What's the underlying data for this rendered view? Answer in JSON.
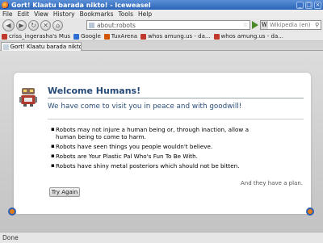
{
  "window": {
    "title": "Gort! Klaatu barada nikto! - Iceweasel",
    "buttons": [
      "_",
      "□",
      "×"
    ]
  },
  "menu": [
    "File",
    "Edit",
    "View",
    "History",
    "Bookmarks",
    "Tools",
    "Help"
  ],
  "nav": {
    "back_icon": "back-arrow",
    "forward_icon": "forward-arrow",
    "reload_icon": "reload",
    "stop_icon": "stop",
    "home_icon": "home",
    "url": "about:robots",
    "search_engine": "W",
    "search_placeholder": "Wikipedia (en)"
  },
  "bookmarks": [
    {
      "label": "criss_ingerasha's Mus",
      "color": "#c0392b"
    },
    {
      "label": "Google",
      "color": "#2f6fd1"
    },
    {
      "label": "TuxArena",
      "color": "#d35400"
    },
    {
      "label": "whos amung.us - da...",
      "color": "#c0392b"
    },
    {
      "label": "whos amung.us - da...",
      "color": "#c0392b"
    }
  ],
  "tab": {
    "label": "Gort! Klaatu barada nikto!"
  },
  "page": {
    "heading": "Welcome Humans!",
    "lead": "We have come to visit you in peace and with goodwill!",
    "laws": [
      "Robots may not injure a human being or, through inaction, allow a human being to come to harm.",
      "Robots have seen things you people wouldn't believe.",
      "Robots are Your Plastic Pal Who's Fun To Be With.",
      "Robots have shiny metal posteriors which should not be bitten."
    ],
    "plan": "And they have a plan.",
    "button": "Try Again",
    "accent": "#264a78"
  },
  "status": "Done"
}
